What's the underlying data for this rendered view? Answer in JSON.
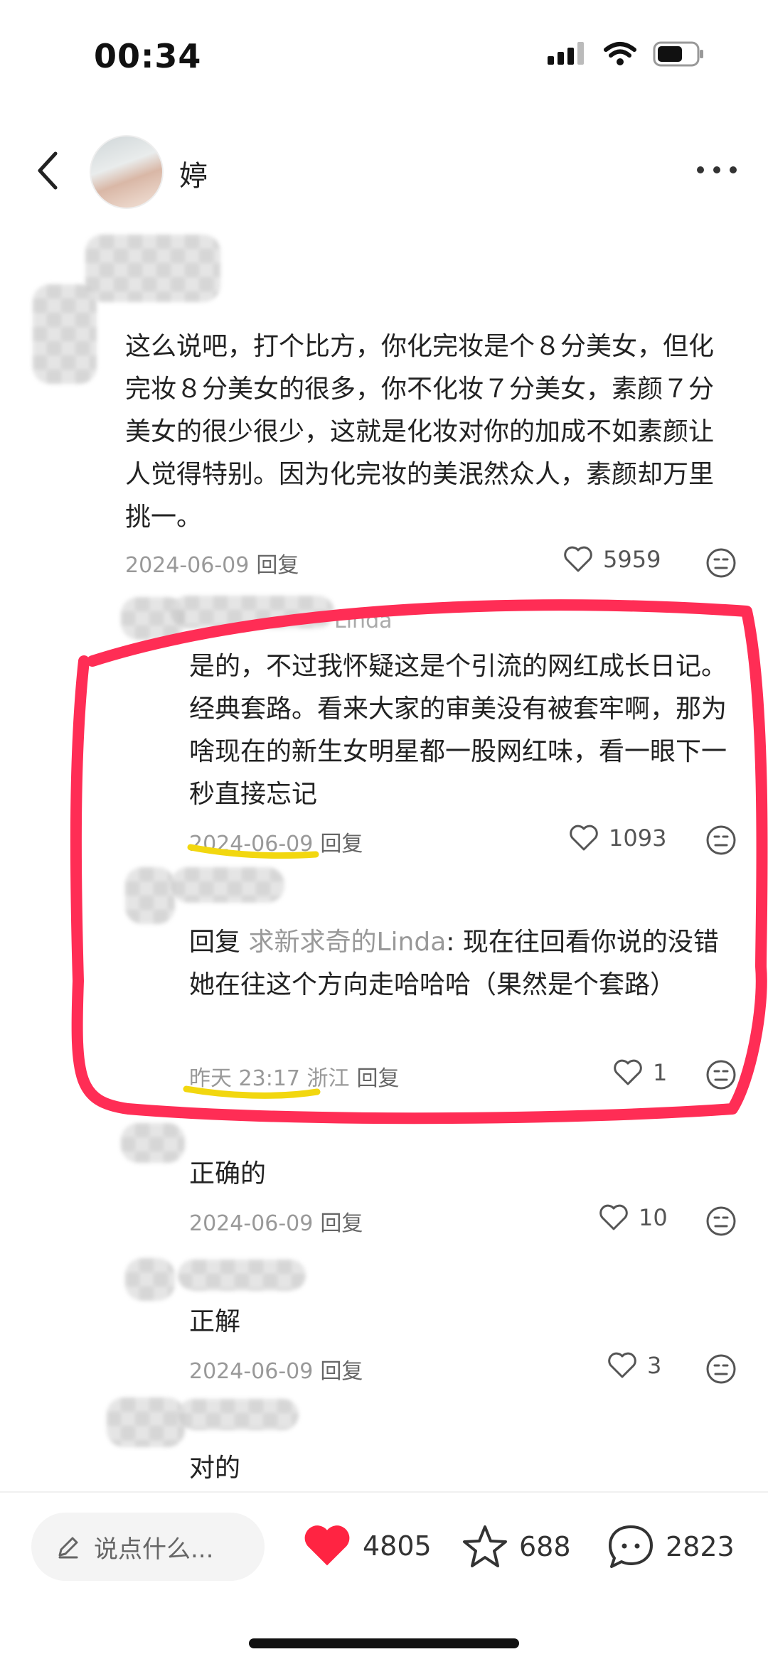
{
  "status_bar": {
    "time": "00:34"
  },
  "header": {
    "name": "婷"
  },
  "comments": [
    {
      "text": "这么说吧，打个比方，你化完妆是个８分美女，但化完妆８分美女的很多，你不化妆７分美女，素颜７分美女的很少很少，这就是化妆对你的加成不如素颜让人觉得特别。因为化完妆的美泯然众人，素颜却万里挑一。",
      "date": "2024-06-09",
      "reply_label": "回复",
      "likes": "5959"
    },
    {
      "handle_visible": "Linda",
      "text": "是的，不过我怀疑这是个引流的网红成长日记。经典套路。看来大家的审美没有被套牢啊，那为啥现在的新生女明星都一股网红味，看一眼下一秒直接忘记",
      "date": "2024-06-09",
      "reply_label": "回复",
      "likes": "1093"
    },
    {
      "prefix": "回复",
      "mention": "求新求奇的Linda",
      "text": ": 现在往回看你说的没错 她在往这个方向走哈哈哈（果然是个套路）",
      "date": "昨天 23:17",
      "location": "浙江",
      "reply_label": "回复",
      "likes": "1"
    },
    {
      "text": "正确的",
      "date": "2024-06-09",
      "reply_label": "回复",
      "likes": "10"
    },
    {
      "text": "正解",
      "date": "2024-06-09",
      "reply_label": "回复",
      "likes": "3"
    },
    {
      "text": "对的"
    }
  ],
  "bottom_bar": {
    "placeholder": "说点什么...",
    "likes": "4805",
    "favorites": "688",
    "comments": "2823"
  },
  "colors": {
    "accent_red": "#ff2d55",
    "highlight_yellow": "#f2d70f",
    "heart_red": "#ff2442"
  }
}
